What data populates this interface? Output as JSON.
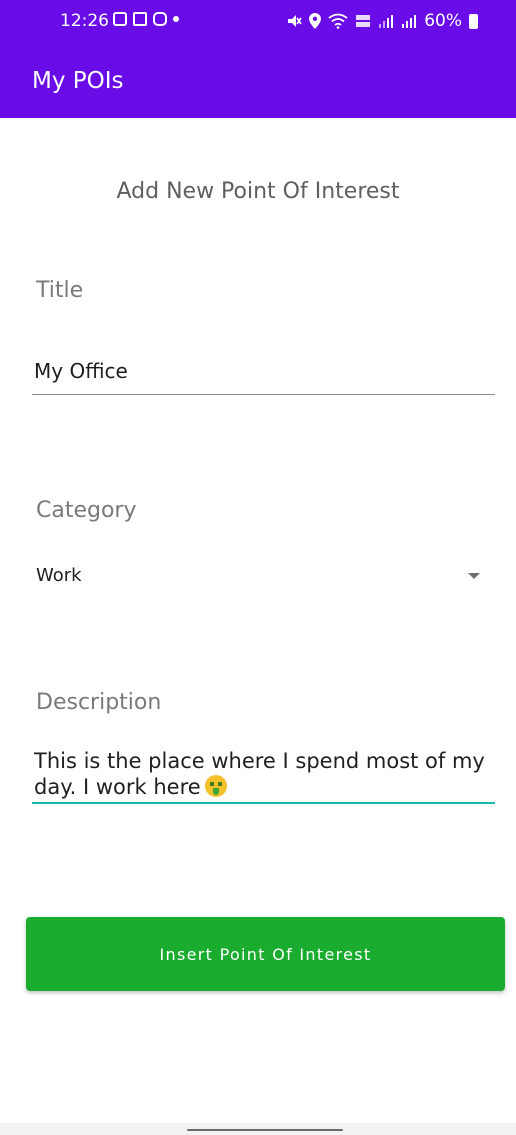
{
  "status_bar": {
    "time": "12:26",
    "battery": "60%",
    "left_icons": [
      "gallery-icon",
      "teams-icon",
      "instagram-icon",
      "dot-icon"
    ],
    "right_icons": [
      "mute-icon",
      "location-icon",
      "wifi-icon",
      "volte-icon",
      "signal-icon",
      "signal-icon",
      "battery-icon"
    ]
  },
  "app_bar": {
    "title": "My POIs",
    "color": "#6a0ce8"
  },
  "form": {
    "heading": "Add New Point Of Interest",
    "title_label": "Title",
    "title_value": "My Office",
    "category_label": "Category",
    "category_value": "Work",
    "description_label": "Description",
    "description_value": "This is the place where I spend most of my day. I work here",
    "description_emoji": "money-mouth-face-emoji",
    "submit_label": "Insert Point Of Interest",
    "submit_color": "#1aac2e",
    "focus_color": "#19b9b0"
  }
}
